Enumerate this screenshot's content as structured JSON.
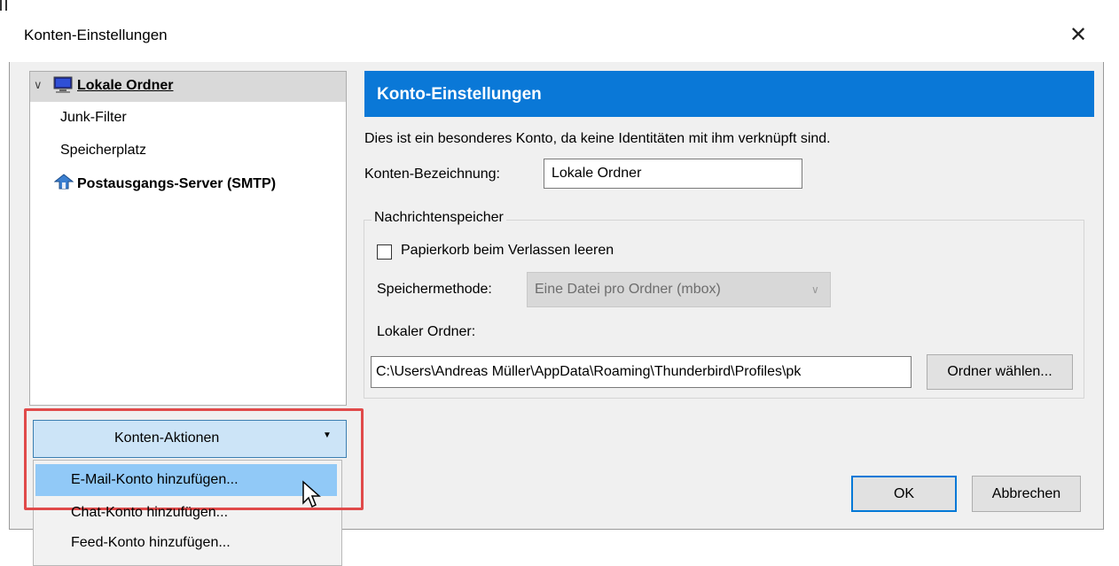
{
  "window": {
    "title": "Konten-Einstellungen",
    "close_glyph": "✕"
  },
  "tree": {
    "items": [
      {
        "label": "Lokale Ordner",
        "icon": "computer-icon",
        "selected": true,
        "expanded": true
      },
      {
        "label": "Junk-Filter"
      },
      {
        "label": "Speicherplatz"
      },
      {
        "label": "Postausgangs-Server (SMTP)",
        "icon": "outgoing-server-icon"
      }
    ]
  },
  "account_actions": {
    "button_label": "Konten-Aktionen",
    "menu_items": [
      {
        "label": "E-Mail-Konto hinzufügen...",
        "highlighted": true
      },
      {
        "label": "Chat-Konto hinzufügen..."
      },
      {
        "label": "Feed-Konto hinzufügen..."
      }
    ]
  },
  "settings": {
    "header": "Konto-Einstellungen",
    "info": "Dies ist ein besonderes Konto, da keine Identitäten mit ihm verknüpft sind.",
    "name_label": "Konten-Bezeichnung:",
    "name_value": "Lokale Ordner",
    "group_title": "Nachrichtenspeicher",
    "empty_trash_label": "Papierkorb beim Verlassen leeren",
    "empty_trash_checked": false,
    "store_method_label": "Speichermethode:",
    "store_method_value": "Eine Datei pro Ordner (mbox)",
    "local_folder_label": "Lokaler Ordner:",
    "local_folder_value": "C:\\Users\\Andreas Müller\\AppData\\Roaming\\Thunderbird\\Profiles\\pk",
    "browse_label": "Ordner wählen..."
  },
  "buttons": {
    "ok": "OK",
    "cancel": "Abbrechen"
  },
  "colors": {
    "header_bg": "#0a78d7",
    "highlight_box": "#e04a4a",
    "menu_highlight": "#91c9f7"
  }
}
